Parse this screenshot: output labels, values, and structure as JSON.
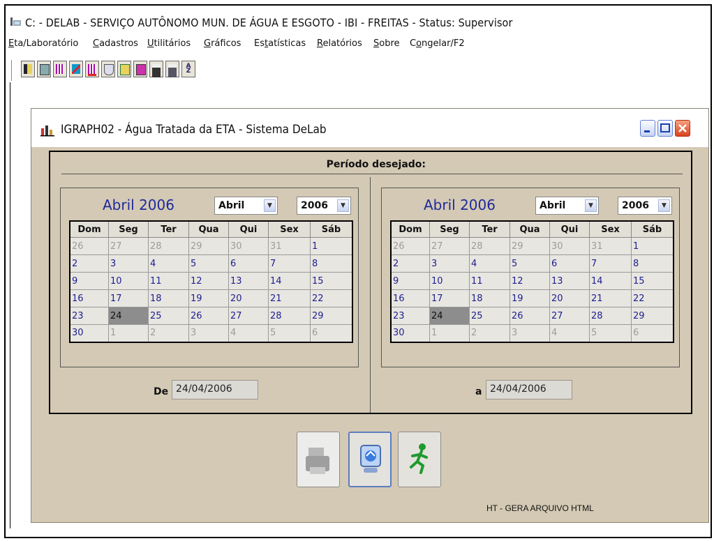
{
  "app": {
    "title": "C: - DELAB - SERVIÇO AUTÔNOMO MUN. DE ÁGUA E ESGOTO - IBI - FREITAS -   Status: Supervisor"
  },
  "menu": [
    {
      "label": "Eta/Laboratório",
      "u": "E",
      "rest": "ta/Laboratório"
    },
    {
      "label": "Cadastros",
      "u": "C",
      "rest": "adastros"
    },
    {
      "label": "Utilitários",
      "u": "U",
      "rest": "tilitários"
    },
    {
      "label": "Gráficos",
      "u": "G",
      "rest": "ráficos"
    },
    {
      "label": "Estatísticas",
      "pre": "Es",
      "u": "t",
      "rest": "atísticas"
    },
    {
      "label": "Relatórios",
      "u": "R",
      "rest": "elatórios"
    },
    {
      "label": "Sobre",
      "u": "S",
      "rest": "obre"
    },
    {
      "label": "Congelar/F2",
      "pre": "C",
      "u": "o",
      "rest": "ngelar/F2"
    }
  ],
  "toolbar_icons": [
    "exit-icon",
    "edit-icon",
    "grid-icon",
    "chart-icon",
    "grid-red-icon",
    "inbox-icon",
    "mail-icon",
    "book-icon",
    "save-icon",
    "save-as-icon",
    "sort-az-icon"
  ],
  "child": {
    "title": "IGRAPH02 - Água Tratada da ETA - Sistema DeLab",
    "period_label": "Período desejado:",
    "from_label": "De",
    "to_label": "a",
    "from_date": "24/04/2006",
    "to_date": "24/04/2006",
    "status_text": "HT - GERA ARQUIVO HTML"
  },
  "calendar": {
    "month_title": "Abril 2006",
    "month_select": "Abril",
    "year_select": "2006",
    "weekdays": [
      "Dom",
      "Seg",
      "Ter",
      "Qua",
      "Qui",
      "Sex",
      "Sáb"
    ],
    "weeks": [
      [
        "26",
        "27",
        "28",
        "29",
        "30",
        "31",
        "1"
      ],
      [
        "2",
        "3",
        "4",
        "5",
        "6",
        "7",
        "8"
      ],
      [
        "9",
        "10",
        "11",
        "12",
        "13",
        "14",
        "15"
      ],
      [
        "16",
        "17",
        "18",
        "19",
        "20",
        "21",
        "22"
      ],
      [
        "23",
        "24",
        "25",
        "26",
        "27",
        "28",
        "29"
      ],
      [
        "30",
        "1",
        "2",
        "3",
        "4",
        "5",
        "6"
      ]
    ],
    "selected_day": "24"
  },
  "colors": {
    "window_bg": "#d4c9b4",
    "month_title": "#1f2a9a",
    "day_text": "#1b1f8f",
    "selected_day_bg": "#8d8d8d"
  }
}
